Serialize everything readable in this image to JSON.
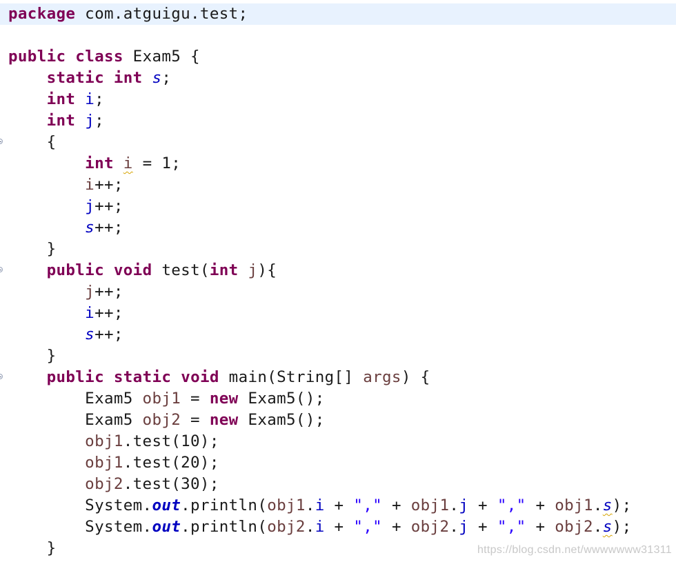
{
  "editor": {
    "colors": {
      "keyword": "#7f0055",
      "field": "#0000c0",
      "string": "#2a00ff",
      "local_variable": "#6a3e3e",
      "current_line_highlight": "#e8f2fe",
      "warning_underline": "#d6a300"
    },
    "fold_markers": [
      "collapse-icon",
      "collapse-icon",
      "collapse-icon"
    ],
    "lines": [
      {
        "tokens": [
          "package",
          " com.atguigu.test;"
        ]
      },
      {
        "tokens": [
          ""
        ]
      },
      {
        "tokens": [
          "public",
          " ",
          "class",
          " Exam5 {"
        ]
      },
      {
        "tokens": [
          "    ",
          "static",
          " ",
          "int",
          " ",
          "s",
          ";"
        ]
      },
      {
        "tokens": [
          "    ",
          "int",
          " ",
          "i",
          ";"
        ]
      },
      {
        "tokens": [
          "    ",
          "int",
          " ",
          "j",
          ";"
        ]
      },
      {
        "tokens": [
          "    {"
        ]
      },
      {
        "tokens": [
          "        ",
          "int",
          " ",
          "i",
          " = 1;"
        ]
      },
      {
        "tokens": [
          "        ",
          "i",
          "++;"
        ]
      },
      {
        "tokens": [
          "        ",
          "j",
          "++;"
        ]
      },
      {
        "tokens": [
          "        ",
          "s",
          "++;"
        ]
      },
      {
        "tokens": [
          "    }"
        ]
      },
      {
        "tokens": [
          "    ",
          "public",
          " ",
          "void",
          " test(",
          "int",
          " ",
          "j",
          "){"
        ]
      },
      {
        "tokens": [
          "        ",
          "j",
          "++;"
        ]
      },
      {
        "tokens": [
          "        ",
          "i",
          "++;"
        ]
      },
      {
        "tokens": [
          "        ",
          "s",
          "++;"
        ]
      },
      {
        "tokens": [
          "    }"
        ]
      },
      {
        "tokens": [
          "    ",
          "public",
          " ",
          "static",
          " ",
          "void",
          " main(String[] ",
          "args",
          ") {"
        ]
      },
      {
        "tokens": [
          "        Exam5 ",
          "obj1",
          " = ",
          "new",
          " Exam5();"
        ]
      },
      {
        "tokens": [
          "        Exam5 ",
          "obj2",
          " = ",
          "new",
          " Exam5();"
        ]
      },
      {
        "tokens": [
          "        ",
          "obj1",
          ".test(10);"
        ]
      },
      {
        "tokens": [
          "        ",
          "obj1",
          ".test(20);"
        ]
      },
      {
        "tokens": [
          "        ",
          "obj2",
          ".test(30);"
        ]
      },
      {
        "tokens": [
          "        System.",
          "out",
          ".println(",
          "obj1",
          ".",
          "i",
          " + ",
          "\",\"",
          " + ",
          "obj1",
          ".",
          "j",
          " + ",
          "\",\"",
          " + ",
          "obj1",
          ".",
          "s",
          ");"
        ]
      },
      {
        "tokens": [
          "        System.",
          "out",
          ".println(",
          "obj2",
          ".",
          "i",
          " + ",
          "\",\"",
          " + ",
          "obj2",
          ".",
          "j",
          " + ",
          "\",\"",
          " + ",
          "obj2",
          ".",
          "s",
          ");"
        ]
      },
      {
        "tokens": [
          "    }"
        ]
      }
    ]
  },
  "watermark": "https://blog.csdn.net/wwwwwww31311"
}
